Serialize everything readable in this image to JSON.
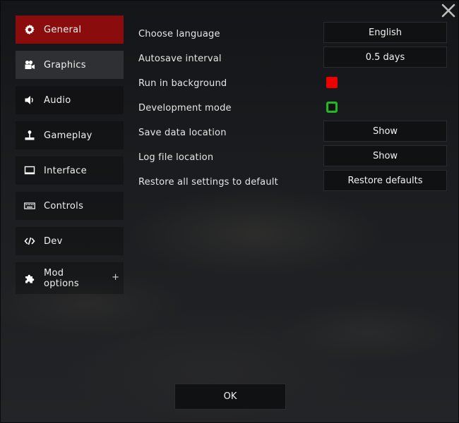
{
  "sidebar": {
    "items": [
      {
        "label": "General",
        "icon": "gear-icon"
      },
      {
        "label": "Graphics",
        "icon": "camera-icon"
      },
      {
        "label": "Audio",
        "icon": "speaker-icon"
      },
      {
        "label": "Gameplay",
        "icon": "joystick-icon"
      },
      {
        "label": "Interface",
        "icon": "monitor-icon"
      },
      {
        "label": "Controls",
        "icon": "keyboard-icon"
      },
      {
        "label": "Dev",
        "icon": "code-icon"
      },
      {
        "label": "Mod options",
        "icon": "puzzle-icon",
        "expand": "+"
      }
    ]
  },
  "settings": {
    "language": {
      "label": "Choose language",
      "value": "English"
    },
    "autosave": {
      "label": "Autosave interval",
      "value": "0.5 days"
    },
    "run_background": {
      "label": "Run in background",
      "checked": false,
      "color": "#ee0000"
    },
    "dev_mode": {
      "label": "Development mode",
      "checked": true,
      "color": "#1ebb1e"
    },
    "save_location": {
      "label": "Save data location",
      "button": "Show"
    },
    "log_location": {
      "label": "Log file location",
      "button": "Show"
    },
    "restore": {
      "label": "Restore all settings to default",
      "button": "Restore defaults"
    }
  },
  "footer": {
    "ok_label": "OK"
  },
  "colors": {
    "accent": "#8b0c0c",
    "hover": "#2e3033"
  }
}
